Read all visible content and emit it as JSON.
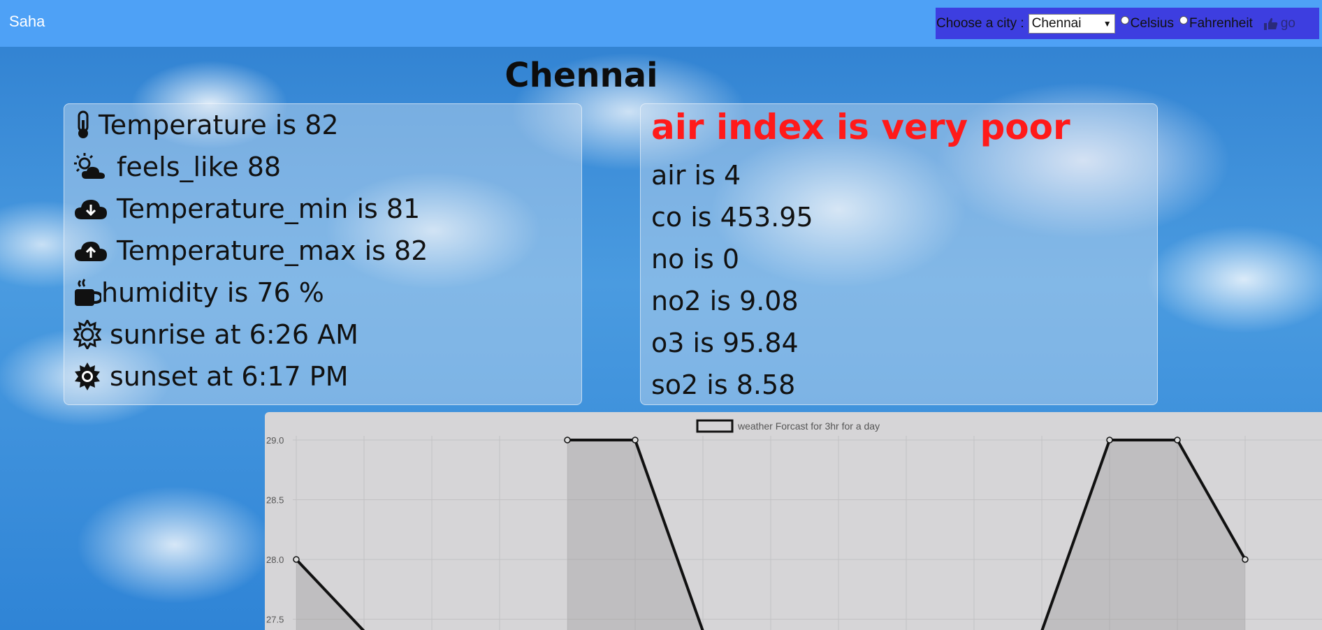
{
  "app": {
    "brand": "Saha"
  },
  "controls": {
    "city_label": "Choose a city :",
    "city_selected": "Chennai",
    "unit_options": [
      "Celsius",
      "Fahrenheit"
    ],
    "go_label": "go"
  },
  "city_title": "Chennai",
  "weather": [
    {
      "icon": "thermometer-icon",
      "text": "Temperature is 82"
    },
    {
      "icon": "sun-cloud-icon",
      "text": "feels_like 88"
    },
    {
      "icon": "cloud-download-icon",
      "text": "Temperature_min is 81"
    },
    {
      "icon": "cloud-upload-icon",
      "text": "Temperature_max is 82"
    },
    {
      "icon": "mug-icon",
      "text": "humidity is 76 %"
    },
    {
      "icon": "sun-outline-icon",
      "text": "sunrise at 6:26 AM"
    },
    {
      "icon": "sun-solid-icon",
      "text": "sunset at 6:17 PM"
    }
  ],
  "air": {
    "title": "air index is very poor",
    "lines": [
      "air is 4",
      "co is 453.95",
      "no is 0",
      "no2 is 9.08",
      "o3 is 95.84",
      "so2 is 8.58"
    ]
  },
  "colors": {
    "topbar": "#4ea1f6",
    "controls_bg": "#3d3ee0",
    "aq_alert": "#ff1a1a",
    "chart_bg": "#d6d5d7"
  },
  "chart_data": {
    "type": "area",
    "legend": "weather Forcast for 3hr for a day",
    "legend_position": "top",
    "grid": true,
    "y_ticks": [
      "29.0",
      "28.5",
      "28.0",
      "27.5"
    ],
    "ylim": [
      27.5,
      29.0
    ],
    "x_count": 15,
    "series": [
      {
        "values": [
          28.0,
          27.4,
          null,
          null,
          29.0,
          29.0,
          27.4,
          null,
          null,
          null,
          null,
          27.4,
          29.0,
          29.0,
          28.0
        ]
      }
    ]
  }
}
